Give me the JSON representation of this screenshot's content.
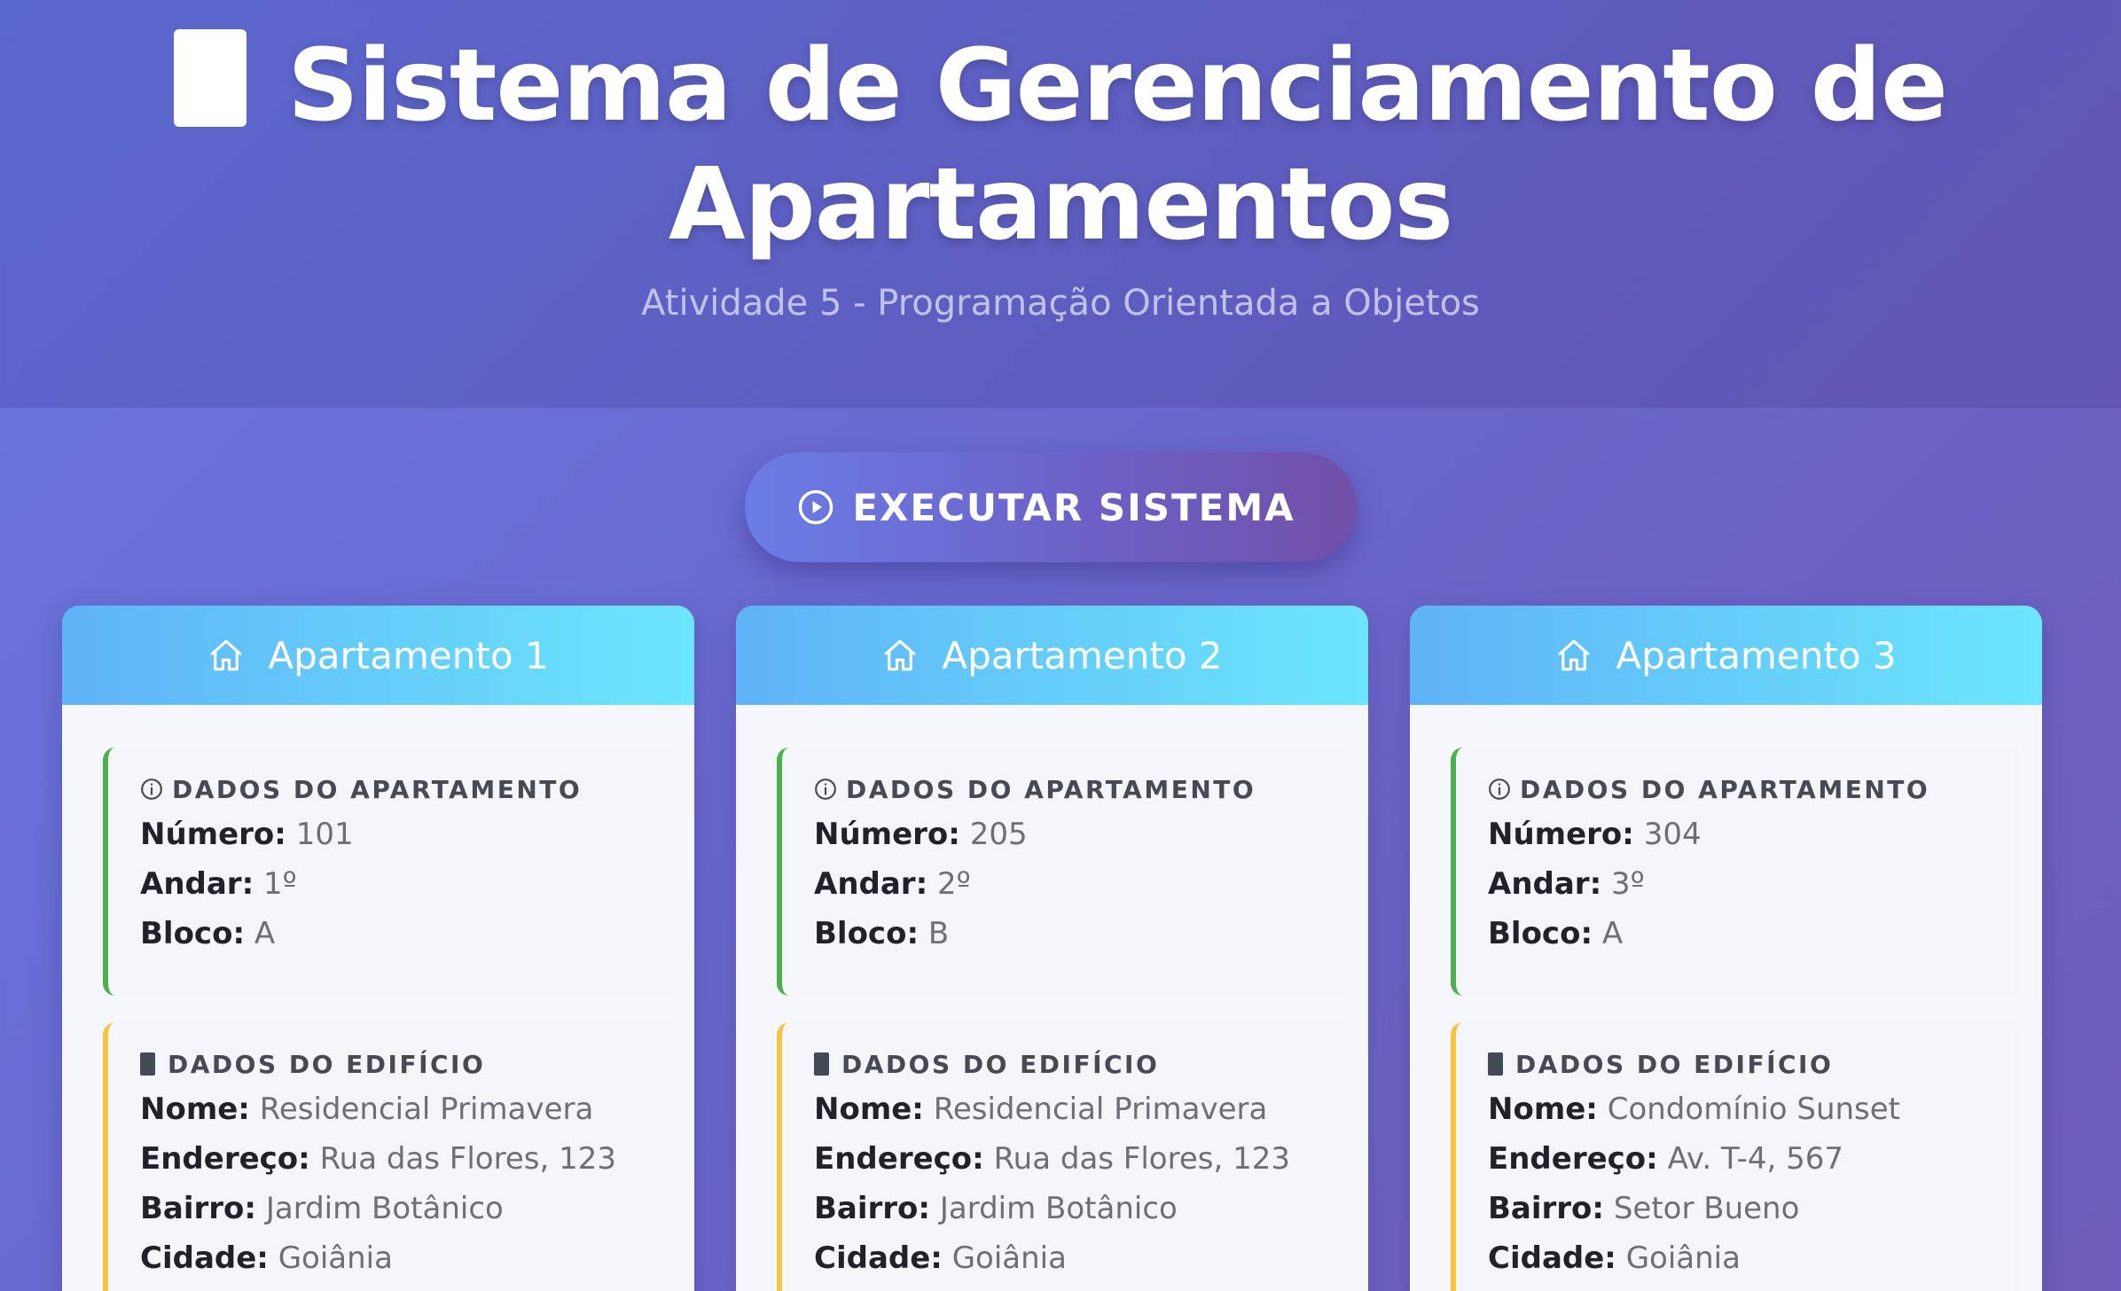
{
  "header": {
    "title": "Sistema de Gerenciamento de Apartamentos",
    "subtitle": "Atividade 5 - Programação Orientada a Objetos"
  },
  "action": {
    "execute_label": "EXECUTAR SISTEMA"
  },
  "labels": {
    "apt_section": "DADOS DO APARTAMENTO",
    "bld_section": "DADOS DO EDIFÍCIO",
    "numero": "Número:",
    "andar": "Andar:",
    "bloco": "Bloco:",
    "nome": "Nome:",
    "endereco": "Endereço:",
    "bairro": "Bairro:",
    "cidade": "Cidade:"
  },
  "apartments": [
    {
      "title": "Apartamento 1",
      "numero": "101",
      "andar": "1º",
      "bloco": "A",
      "nome": "Residencial Primavera",
      "endereco": "Rua das Flores, 123",
      "bairro": "Jardim Botânico",
      "cidade": "Goiânia"
    },
    {
      "title": "Apartamento 2",
      "numero": "205",
      "andar": "2º",
      "bloco": "B",
      "nome": "Residencial Primavera",
      "endereco": "Rua das Flores, 123",
      "bairro": "Jardim Botânico",
      "cidade": "Goiânia"
    },
    {
      "title": "Apartamento 3",
      "numero": "304",
      "andar": "3º",
      "bloco": "A",
      "nome": "Condomínio Sunset",
      "endereco": "Av. T-4, 567",
      "bairro": "Setor Bueno",
      "cidade": "Goiânia"
    }
  ],
  "colors": {
    "apt_accent": "#4caf50",
    "bld_accent": "#f4c542",
    "card_header_start": "#5fb3f7",
    "card_header_end": "#6be6fc"
  },
  "icons": {
    "title": "building-icon",
    "button": "play-circle-icon",
    "card": "home-icon",
    "apt_section": "info-icon",
    "bld_section": "building-icon"
  }
}
